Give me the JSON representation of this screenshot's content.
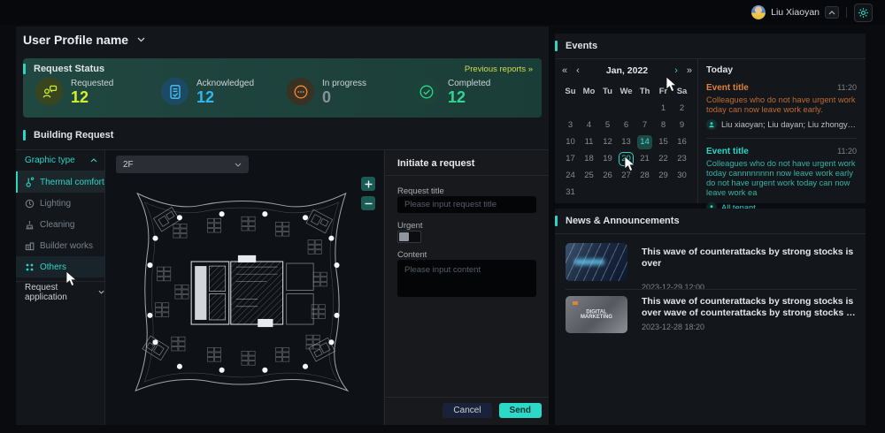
{
  "colors": {
    "accent": "#2bd5c6",
    "requested": "#d6ef2b",
    "acknowledged": "#2eb7f0",
    "in_progress": "#8a9099",
    "completed": "#2ed694",
    "reports_link": "#cedd50",
    "event_orange": "#e2813a",
    "send_button": "#2cd8c8"
  },
  "topbar": {
    "user_name": "Liu Xiaoyan"
  },
  "page": {
    "title": "User Profile name"
  },
  "request_status": {
    "title": "Request Status",
    "link": "Previous reports »",
    "stats": [
      {
        "label": "Requested",
        "value": "12",
        "icon": "person-chat-icon"
      },
      {
        "label": "Acknowledged",
        "value": "12",
        "icon": "document-check-icon"
      },
      {
        "label": "In progress",
        "value": "0",
        "icon": "ellipsis-circle-icon"
      },
      {
        "label": "Completed",
        "value": "12",
        "icon": "check-circle-icon"
      }
    ]
  },
  "building_request": {
    "title": "Building Request",
    "graphic_type": "Graphic type",
    "types": [
      "Thermal comfort",
      "Lighting",
      "Cleaning",
      "Builder works",
      "Others"
    ],
    "request_application": "Request application",
    "floor": "2F",
    "form": {
      "title": "Initiate a request",
      "request_title_label": "Request title",
      "request_title_placeholder": "Please input request title",
      "urgent_label": "Urgent",
      "content_label": "Content",
      "content_placeholder": "Please input content",
      "cancel": "Cancel",
      "send": "Send"
    }
  },
  "events": {
    "title": "Events",
    "calendar": {
      "nav": [
        "«",
        "‹",
        "›",
        "»"
      ],
      "month": "Jan, 2022",
      "day_headers": [
        "Su",
        "Mo",
        "Tu",
        "We",
        "Th",
        "Fr",
        "Sa"
      ],
      "weeks": [
        [
          "",
          "",
          "",
          "",
          "",
          "1",
          "2"
        ],
        [
          "3",
          "4",
          "5",
          "6",
          "7",
          "8",
          "9"
        ],
        [
          "10",
          "11",
          "12",
          "13",
          "14",
          "15",
          "16"
        ],
        [
          "17",
          "18",
          "19",
          "20",
          "21",
          "22",
          "23"
        ],
        [
          "24",
          "25",
          "26",
          "27",
          "28",
          "29",
          "30"
        ],
        [
          "31",
          "",
          "",
          "",
          "",
          "",
          ""
        ]
      ],
      "selected_day": "14",
      "outlined_day": "20"
    },
    "today": {
      "label": "Today",
      "items": [
        {
          "title": "Event title",
          "time": "11:20",
          "desc": "Colleagues who do not have urgent work today can now leave work early.",
          "attendees": "Liu xiaoyan; Liu dayan;  Liu zhongyan; Liu sanjin; Liu si"
        },
        {
          "title": "Event title",
          "time": "11:20",
          "desc": "Colleagues who do not have urgent work today cannnnnnnn now leave work early do not have urgent work today can now leave work ea",
          "attendees": "All tenant"
        }
      ]
    }
  },
  "news": {
    "title": "News & Announcements",
    "items": [
      {
        "title": "This wave of counterattacks by strong stocks is over",
        "date": "2023-12-29 12:00"
      },
      {
        "title": "This wave of counterattacks by strong stocks is over wave of counterattacks by strong stocks is overrrrrrrrrrrrrrrrrrrrrrrrrrrrrrrrrrrrrrrrr",
        "date": "2023-12-28 18:20",
        "thumb_text": "DIGITAL MARKETING"
      }
    ]
  }
}
